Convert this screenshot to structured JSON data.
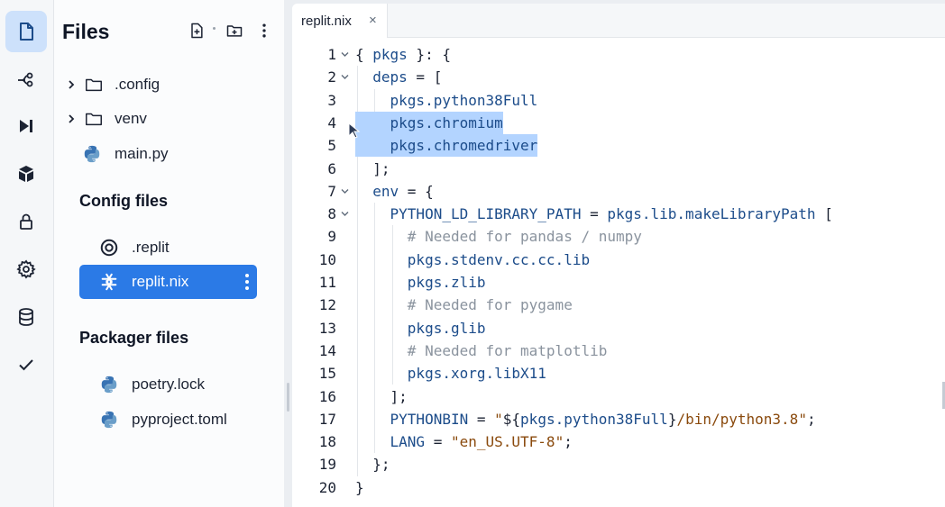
{
  "activity_bar": {
    "items": [
      {
        "name": "files-icon",
        "active": true
      },
      {
        "name": "git-icon",
        "active": false
      },
      {
        "name": "run-icon",
        "active": false
      },
      {
        "name": "packages-icon",
        "active": false
      },
      {
        "name": "lock-icon",
        "active": false
      },
      {
        "name": "settings-icon",
        "active": false
      },
      {
        "name": "database-icon",
        "active": false
      },
      {
        "name": "check-icon",
        "active": false
      }
    ]
  },
  "files_panel": {
    "title": "Files",
    "tree": [
      {
        "label": ".config",
        "type": "folder"
      },
      {
        "label": "venv",
        "type": "folder"
      },
      {
        "label": "main.py",
        "type": "python"
      }
    ],
    "config_section": {
      "title": "Config files",
      "items": [
        {
          "label": ".replit",
          "icon": "replit-icon"
        },
        {
          "label": "replit.nix",
          "icon": "nix-icon",
          "selected": true
        }
      ]
    },
    "packager_section": {
      "title": "Packager files",
      "items": [
        {
          "label": "poetry.lock",
          "icon": "python-icon"
        },
        {
          "label": "pyproject.toml",
          "icon": "python-icon"
        }
      ]
    }
  },
  "editor": {
    "tab": {
      "label": "replit.nix",
      "close": "×"
    },
    "lines": [
      {
        "n": "1",
        "text": "{ pkgs }: {"
      },
      {
        "n": "2",
        "text": "  deps = ["
      },
      {
        "n": "3",
        "text": "    pkgs.python38Full"
      },
      {
        "n": "4",
        "text": "    pkgs.chromium"
      },
      {
        "n": "5",
        "text": "    pkgs.chromedriver"
      },
      {
        "n": "6",
        "text": "  ];"
      },
      {
        "n": "7",
        "text": "  env = {"
      },
      {
        "n": "8",
        "text": "    PYTHON_LD_LIBRARY_PATH = pkgs.lib.makeLibraryPath ["
      },
      {
        "n": "9",
        "text": "      # Needed for pandas / numpy"
      },
      {
        "n": "10",
        "text": "      pkgs.stdenv.cc.cc.lib"
      },
      {
        "n": "11",
        "text": "      pkgs.zlib"
      },
      {
        "n": "12",
        "text": "      # Needed for pygame"
      },
      {
        "n": "13",
        "text": "      pkgs.glib"
      },
      {
        "n": "14",
        "text": "      # Needed for matplotlib"
      },
      {
        "n": "15",
        "text": "      pkgs.xorg.libX11"
      },
      {
        "n": "16",
        "text": "    ];"
      },
      {
        "n": "17",
        "text": "    PYTHONBIN = \"${pkgs.python38Full}/bin/python3.8\";"
      },
      {
        "n": "18",
        "text": "    LANG = \"en_US.UTF-8\";"
      },
      {
        "n": "19",
        "text": "  };"
      },
      {
        "n": "20",
        "text": "}"
      }
    ],
    "folded_lines": [
      "1",
      "2",
      "7",
      "8"
    ],
    "selected_lines": [
      "4",
      "5"
    ]
  },
  "colors": {
    "accent": "#2b7ae6",
    "selection": "#b3d4ff",
    "active_activity": "#cde1fb"
  }
}
